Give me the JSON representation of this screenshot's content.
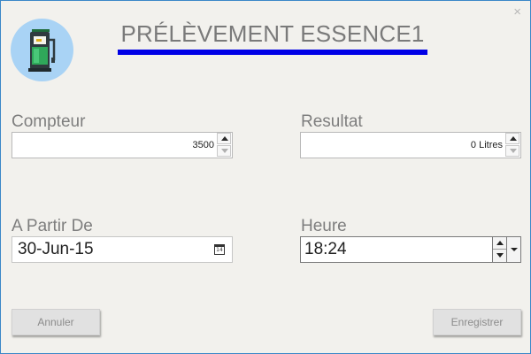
{
  "window": {
    "close_label": "×"
  },
  "header": {
    "title": "PRÉLÈVEMENT ESSENCE1",
    "accent_color": "#0000e6",
    "logo_icon": "fuel-pump-icon"
  },
  "form": {
    "compteur": {
      "label": "Compteur",
      "value": "3500"
    },
    "resultat": {
      "label": "Resultat",
      "value": "0 Litres"
    },
    "a_partir_de": {
      "label": "A Partir De",
      "value": "30-Jun-15",
      "calendar_day": "14"
    },
    "heure": {
      "label": "Heure",
      "value": "18:24"
    }
  },
  "actions": {
    "cancel_label": "Annuler",
    "save_label": "Enregistrer"
  }
}
